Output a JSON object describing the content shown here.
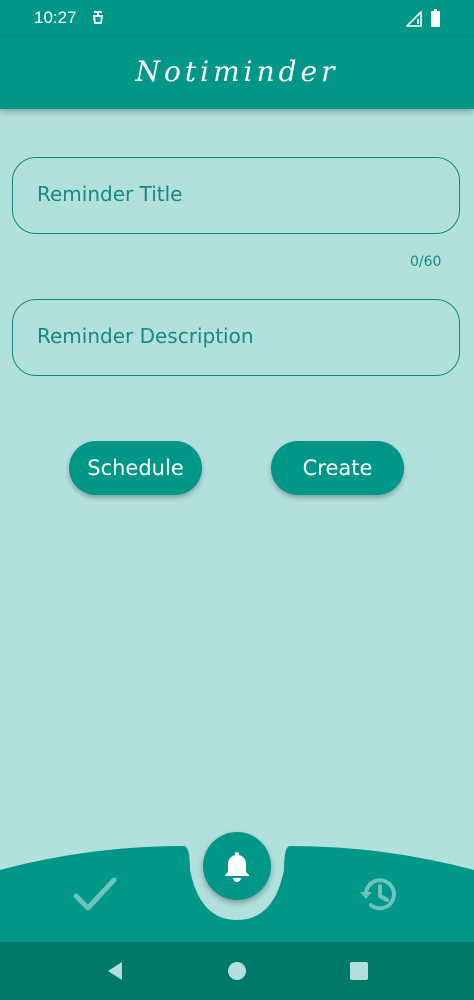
{
  "status_bar": {
    "time": "10:27"
  },
  "app_bar": {
    "title": "Notiminder"
  },
  "form": {
    "title_placeholder": "Reminder Title",
    "title_counter": "0/60",
    "description_placeholder": "Reminder Description"
  },
  "actions": {
    "schedule_label": "Schedule",
    "create_label": "Create"
  },
  "bottom_nav": {
    "items": [
      {
        "icon": "check-icon"
      },
      {
        "icon": "bell-icon",
        "selected": true
      },
      {
        "icon": "history-icon"
      }
    ]
  },
  "colors": {
    "primary": "#009688",
    "background": "#b2e0dc",
    "nav_bar": "#00796b",
    "text_accent": "#178a80"
  }
}
